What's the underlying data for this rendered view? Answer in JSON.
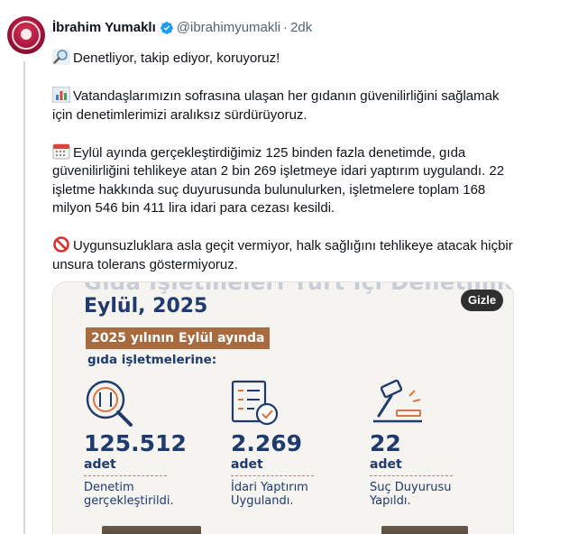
{
  "tweet": {
    "author_name": "İbrahim Yumaklı",
    "handle": "@ibrahimyumakli",
    "separator": "·",
    "time": "2dk",
    "paragraphs": [
      {
        "emoji": "magnifier-icon",
        "text": "Denetliyor, takip ediyor, koruyoruz!"
      },
      {
        "emoji": "bar-chart-icon",
        "text": "Vatandaşlarımızın sofrasına ulaşan her gıdanın güvenilirliğini sağlamak için denetimlerimizi aralıksız sürdürüyoruz."
      },
      {
        "emoji": "calendar-icon",
        "text": "Eylül ayında gerçekleştirdiğimiz 125 binden fazla denetimde, gıda güvenilirliğini tehlikeye atan 2 bin 269 işletmeye idari yaptırım uygulandı. 22 işletme hakkında suç duyurusunda bulunulurken, işletmelere toplam 168 milyon 546 bin 411 lira idari para cezası kesildi."
      },
      {
        "emoji": "prohibited-icon",
        "text": "Uygunsuzluklara asla geçit vermiyor, halk sağlığını tehlikeye atacak hiçbir unsura tolerans göstermiyoruz."
      }
    ]
  },
  "media": {
    "hide_label": "Gizle",
    "title_partial": "Gıda İşletmeleri Yurt İçi Denetimleri",
    "title": "Eylül, 2025",
    "banner": "2025 yılının Eylül ayında",
    "subtitle": "gıda işletmelerine:",
    "stats": [
      {
        "icon": "magnifier-plate-icon",
        "value": "125.512",
        "unit": "adet",
        "desc": "Denetim gerçekleştirildi."
      },
      {
        "icon": "checklist-icon",
        "value": "2.269",
        "unit": "adet",
        "desc": "İdari Yaptırım Uygulandı."
      },
      {
        "icon": "gavel-icon",
        "value": "22",
        "unit": "adet",
        "desc": "Suç Duyurusu Yapıldı."
      }
    ]
  },
  "colors": {
    "navy": "#1f3a6d",
    "banner_brown": "#a86a3f",
    "accent_orange": "#d9763f",
    "verified_blue": "#1d9bf0"
  }
}
